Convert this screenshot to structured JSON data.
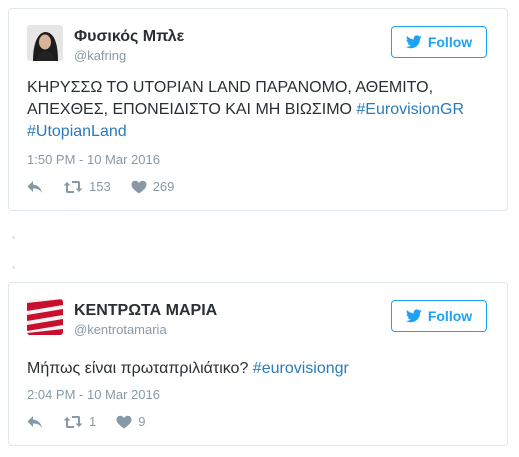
{
  "tweets": [
    {
      "display_name": "Φυσικός Μπλε",
      "handle": "@kafring",
      "follow_label": "Follow",
      "text_plain": "ΚΗΡΥΣΣΩ ΤΟ UTOPIAN LAND ΠΑΡΑΝΟΜΟ, ΑΘΕΜΙΤΟ, ΑΠΕΧΘΕΣ, ΕΠΟΝΕΙΔΙΣΤΟ ΚΑΙ ΜΗ ΒΙΩΣΙΜΟ ",
      "hashtag1": "#EurovisionGR",
      "hashtag2": "#UtopianLand",
      "timestamp": "1:50 PM - 10 Mar 2016",
      "retweets": "153",
      "likes": "269",
      "icons": {
        "bird": "twitter-bird-icon",
        "reply": "reply-icon",
        "retweet": "retweet-icon",
        "like": "heart-icon"
      }
    },
    {
      "display_name": "ΚΕΝΤΡΩΤΑ ΜΑΡΙΑ",
      "handle": "@kentrotamaria",
      "follow_label": "Follow",
      "text_plain": "Μήπως είναι πρωταπριλιάτικο? ",
      "hashtag1": "#eurovisiongr",
      "timestamp": "2:04 PM - 10 Mar 2016",
      "retweets": "1",
      "likes": "9",
      "icons": {
        "bird": "twitter-bird-icon",
        "reply": "reply-icon",
        "retweet": "retweet-icon",
        "like": "heart-icon"
      }
    }
  ],
  "colors": {
    "accent": "#1da1f2",
    "link": "#2b7bb9",
    "muted": "#8899a6",
    "border": "#e1e8ed",
    "text": "#292f33"
  }
}
